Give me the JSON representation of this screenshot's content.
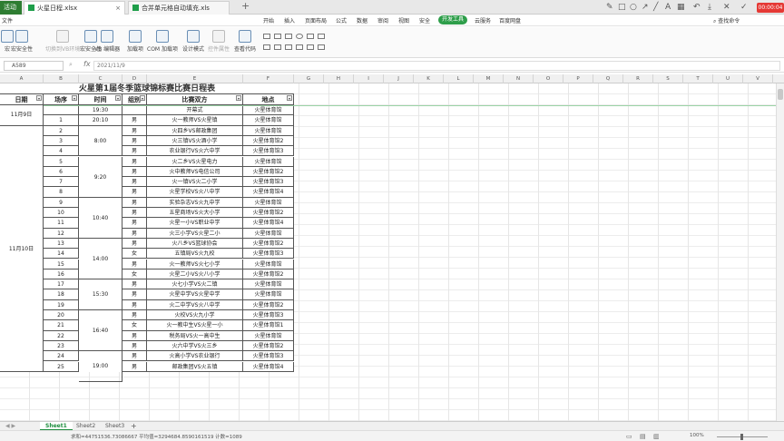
{
  "titlebar": {
    "home": "活动",
    "tabs": [
      {
        "label": "火星日程.xlsx"
      },
      {
        "label": "合并单元格自动填充.xls"
      }
    ],
    "new_tab": "+",
    "record": "00:00:04"
  },
  "menu": {
    "file": "文件",
    "items": [
      "开始",
      "插入",
      "页面布局",
      "公式",
      "数据",
      "审阅",
      "视图",
      "安全",
      "开发工具",
      "云服务",
      "百度网盘"
    ],
    "active": "开发工具",
    "search": "查找命令"
  },
  "ribbon": {
    "buttons": [
      {
        "label": "宏",
        "dim": false
      },
      {
        "label": "宏安全性",
        "dim": false
      },
      {
        "label": "切换到VB环境",
        "dim": true
      },
      {
        "label": "宏安全性",
        "dim": false
      },
      {
        "label": "VB 编辑器",
        "dim": false
      },
      {
        "label": "加载项",
        "dim": false
      },
      {
        "label": "COM 加载项",
        "dim": false
      },
      {
        "label": "设计模式",
        "dim": false
      },
      {
        "label": "控件属性",
        "dim": true
      },
      {
        "label": "查看代码",
        "dim": false
      }
    ]
  },
  "formula": {
    "name_box": "A589",
    "fx": "fx",
    "content": "2021/11/9"
  },
  "columns": [
    "A",
    "B",
    "C",
    "D",
    "E",
    "F",
    "G",
    "H",
    "I",
    "J",
    "K",
    "L",
    "M",
    "N",
    "O",
    "P",
    "Q",
    "R",
    "S",
    "T",
    "U",
    "V"
  ],
  "table": {
    "title": "火星第1届冬季篮球锦标赛比赛日程表",
    "headers": [
      "日期",
      "场序",
      "时间",
      "组别",
      "比赛双方",
      "地点"
    ],
    "opening": {
      "time": "19:30",
      "match": "开幕式",
      "venue": "火星体育馆"
    },
    "dates": [
      "11月9日",
      "11月10日"
    ],
    "time_groups": [
      {
        "label": "20:10",
        "rows": 1
      },
      {
        "label": "8:00",
        "rows": 3
      },
      {
        "label": "9:20",
        "rows": 4
      },
      {
        "label": "10:40",
        "rows": 4
      },
      {
        "label": "14:00",
        "rows": 4
      },
      {
        "label": "15:30",
        "rows": 3
      },
      {
        "label": "16:40",
        "rows": 4
      },
      {
        "label": "19:00",
        "rows": 3
      }
    ],
    "rows": [
      {
        "no": "1",
        "group": "男",
        "match": "火一教师VS火星镇",
        "venue": "火星体育馆"
      },
      {
        "no": "2",
        "group": "男",
        "match": "火四乡VS邮政集团",
        "venue": "火星体育馆"
      },
      {
        "no": "3",
        "group": "男",
        "match": "火三镇VS火酒小学",
        "venue": "火星体育馆2"
      },
      {
        "no": "4",
        "group": "男",
        "match": "农业银行VS火六中学",
        "venue": "火星体育馆3"
      },
      {
        "no": "5",
        "group": "男",
        "match": "火二乡VS火星电力",
        "venue": "火星体育馆"
      },
      {
        "no": "6",
        "group": "男",
        "match": "火中教师VS电信公司",
        "venue": "火星体育馆2"
      },
      {
        "no": "7",
        "group": "男",
        "match": "火一镇VS火二小学",
        "venue": "火星体育馆3"
      },
      {
        "no": "8",
        "group": "男",
        "match": "火星学校VS火八中学",
        "venue": "火星体育馆4"
      },
      {
        "no": "9",
        "group": "男",
        "match": "实验杂志VS火九中学",
        "venue": "火星体育馆"
      },
      {
        "no": "10",
        "group": "男",
        "match": "五星商场VS火大小学",
        "venue": "火星体育馆2"
      },
      {
        "no": "11",
        "group": "男",
        "match": "火星一小VS职业中学",
        "venue": "火星体育馆4"
      },
      {
        "no": "12",
        "group": "男",
        "match": "火三小学VS火星二小",
        "venue": "火星体育馆"
      },
      {
        "no": "13",
        "group": "男",
        "match": "火八乡VS篮球协会",
        "venue": "火星体育馆2"
      },
      {
        "no": "14",
        "group": "女",
        "match": "五镇局VS火九校",
        "venue": "火星体育馆3"
      },
      {
        "no": "15",
        "group": "男",
        "match": "火一教师VS火七小学",
        "venue": "火星体育馆"
      },
      {
        "no": "16",
        "group": "女",
        "match": "火星二小VS火八小学",
        "venue": "火星体育馆2"
      },
      {
        "no": "17",
        "group": "男",
        "match": "火七小学VS火二镇",
        "venue": "火星体育馆"
      },
      {
        "no": "18",
        "group": "男",
        "match": "火星中学VS火星中学",
        "venue": "火星体育馆"
      },
      {
        "no": "19",
        "group": "男",
        "match": "火二中学VS火八中学",
        "venue": "火星体育馆2"
      },
      {
        "no": "20",
        "group": "男",
        "match": "火校VS火九小学",
        "venue": "火星体育馆3"
      },
      {
        "no": "21",
        "group": "女",
        "match": "火一教中生VS火星一小",
        "venue": "火星体育馆1"
      },
      {
        "no": "22",
        "group": "男",
        "match": "税务局VS火一高中生",
        "venue": "火星体育馆"
      },
      {
        "no": "23",
        "group": "男",
        "match": "火六中学VS火三乡",
        "venue": "火星体育馆2"
      },
      {
        "no": "24",
        "group": "男",
        "match": "火高小学VS农业银行",
        "venue": "火星体育馆3"
      },
      {
        "no": "25",
        "group": "男",
        "match": "邮政集团VS火五镇",
        "venue": "火星体育馆4"
      }
    ]
  },
  "sheets": [
    "Sheet1",
    "Sheet2",
    "Sheet3"
  ],
  "add_sheet": "+",
  "status": {
    "text": "求和=44751536.73086667  平均值=3294684.8590161519  计数=1089",
    "zoom": "100%"
  }
}
